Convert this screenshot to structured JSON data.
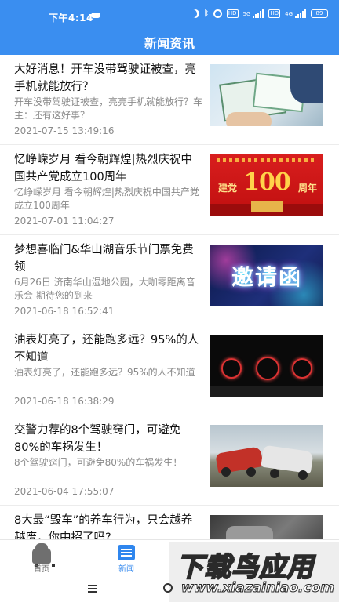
{
  "status_bar": {
    "time": "下午4:14",
    "network_5g": "5G",
    "network_4g": "4G",
    "hd": "HD",
    "battery": "89"
  },
  "app": {
    "title": "新闻资讯"
  },
  "news": [
    {
      "title": "大好消息！开车没带驾驶证被查，亮手机就能放行？",
      "summary": "开车没带驾驶证被查，亮亮手机就能放行？车主：还有这好事？",
      "date": "2021-07-15 13:49:16",
      "thumb": "license-photo"
    },
    {
      "title": "忆峥嵘岁月 看今朝辉煌|热烈庆祝中国共产党成立100周年",
      "summary": "忆峥嵘岁月 看今朝辉煌|热烈庆祝中国共产党成立100周年",
      "date": "2021-07-01 11:04:27",
      "thumb": "party-100-banner",
      "thumb_left": "建党",
      "thumb_big": "100",
      "thumb_right": "周年"
    },
    {
      "title": "梦想喜临门&华山湖音乐节门票免费领",
      "summary": "6月26日 济南华山湿地公园，大咖零距离音乐会 期待您的到来",
      "date": "2021-06-18 16:52:41",
      "thumb": "invitation-card",
      "thumb_word": "邀请函"
    },
    {
      "title": "油表灯亮了，还能跑多远？95%的人不知道",
      "summary": "油表灯亮了，还能跑多远？95%的人不知道",
      "date": "2021-06-18 16:38:29",
      "thumb": "dashboard-gauges"
    },
    {
      "title": "交警力荐的8个驾驶窍门，可避免80%的车祸发生！",
      "summary": "8个驾驶窍门，可避免80%的车祸发生！",
      "date": "2021-06-04 17:55:07",
      "thumb": "crashed-cars"
    },
    {
      "title": "8大最“毁车”的养车行为，只会越养越废，你中招了吗?",
      "summary": "",
      "date": "",
      "thumb": "engine-bay"
    }
  ],
  "bottom_nav": {
    "tabs": [
      {
        "label": "首页",
        "icon": "car-icon",
        "active": false
      },
      {
        "label": "新闻",
        "icon": "news-icon",
        "active": true
      }
    ]
  },
  "watermark": {
    "text": "下载鸟应用",
    "url": "www.xiazainiao.com"
  },
  "colors": {
    "primary": "#3a8ef0",
    "active_tab": "#2f86ee",
    "meta_text": "#8a8a8a"
  }
}
